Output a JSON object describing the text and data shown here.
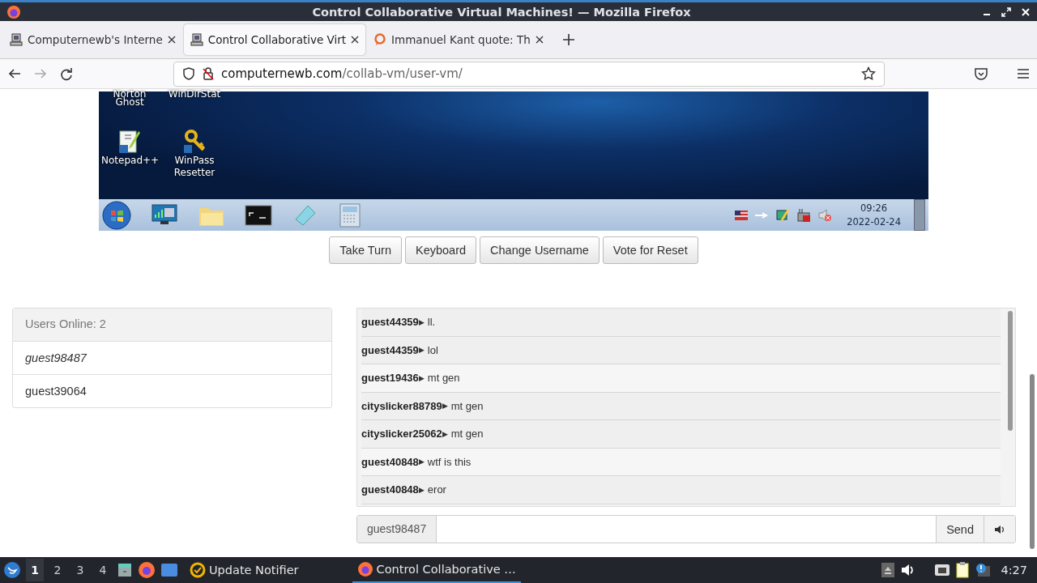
{
  "window": {
    "title": "Control Collaborative Virtual Machines! — Mozilla Firefox"
  },
  "tabs": [
    {
      "label": "Computernewb's Interne",
      "selected": false
    },
    {
      "label": "Control Collaborative Virt",
      "selected": true
    },
    {
      "label": "Immanuel Kant quote: Th",
      "selected": false
    }
  ],
  "address": {
    "host": "computernewb.com",
    "path": "/collab-vm/user-vm/"
  },
  "vm": {
    "desktop_icons": [
      {
        "label": "Norton Ghost",
        "kind": "cut"
      },
      {
        "label": "WinDirStat",
        "kind": "cut"
      },
      {
        "label": "Notepad++",
        "kind": "notepad"
      },
      {
        "label": "WinPass Resetter",
        "kind": "key"
      }
    ],
    "time": "09:26",
    "date": "2022-02-24"
  },
  "buttons": [
    "Take Turn",
    "Keyboard",
    "Change Username",
    "Vote for Reset"
  ],
  "users": {
    "header": "Users Online: 2",
    "list": [
      {
        "name": "guest98487",
        "self": true
      },
      {
        "name": "guest39064",
        "self": false
      }
    ]
  },
  "chat": {
    "messages": [
      {
        "user": "guest44359",
        "marker": "▶",
        "text": "ll."
      },
      {
        "user": "guest44359",
        "marker": "▶",
        "text": "lol"
      },
      {
        "user": "guest19436",
        "marker": "▶",
        "text": "mt gen"
      },
      {
        "user": "cityslicker88789",
        "marker": "▶",
        "text": "mt gen"
      },
      {
        "user": "cityslicker25062",
        "marker": "▶",
        "text": "mt gen"
      },
      {
        "user": "guest40848",
        "marker": "▶",
        "text": "wtf is this"
      },
      {
        "user": "guest40848",
        "marker": "▶",
        "text": "eror"
      }
    ],
    "username": "guest98487",
    "send": "Send"
  },
  "taskbar": {
    "workspaces": [
      {
        "label": "1",
        "selected": true
      },
      {
        "label": "2",
        "selected": false
      },
      {
        "label": "3",
        "selected": false
      },
      {
        "label": "4",
        "selected": false
      }
    ],
    "apps": [
      {
        "label": "Update Notifier"
      }
    ],
    "tasks": [
      {
        "label": "Control Collaborative …",
        "selected": true
      }
    ],
    "clock": "4:27"
  }
}
